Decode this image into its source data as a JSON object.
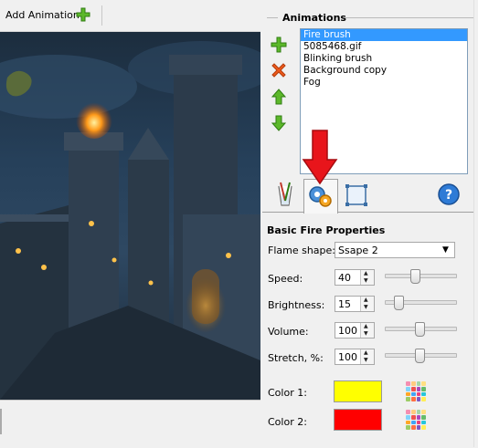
{
  "toolbar": {
    "add_animation_label": "Add Animation"
  },
  "animations": {
    "title": "Animations",
    "items": [
      "Fire brush",
      "5085468.gif",
      "Blinking brush",
      "Background copy",
      "Fog"
    ],
    "selected_index": 0
  },
  "properties": {
    "title": "Basic Fire Properties",
    "flame_shape_label": "Flame shape:",
    "flame_shape_value": "Ssape 2",
    "speed_label": "Speed:",
    "speed_value": "40",
    "speed_level": 0.42,
    "brightness_label": "Brightness:",
    "brightness_value": "15",
    "brightness_level": 0.15,
    "volume_label": "Volume:",
    "volume_value": "100",
    "volume_level": 0.5,
    "stretch_label": "Stretch, %:",
    "stretch_value": "100",
    "stretch_level": 0.5,
    "color1_label": "Color 1:",
    "color1": "#ffff00",
    "color2_label": "Color 2:",
    "color2": "#ff0000"
  },
  "icons": {
    "add": "plus-icon",
    "remove": "delete-icon",
    "up": "move-up-icon",
    "down": "move-down-icon",
    "help": "help-icon"
  }
}
